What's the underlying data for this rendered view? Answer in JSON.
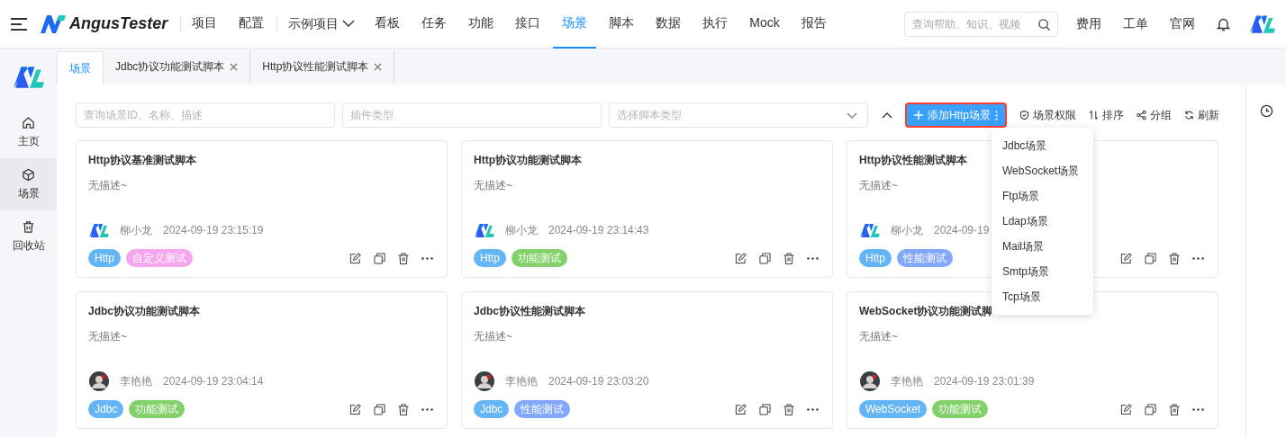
{
  "header": {
    "brand": "AngusTester",
    "settings_menu": [
      {
        "label": "项目",
        "selected": false
      },
      {
        "label": "配置",
        "selected": false
      }
    ],
    "project_selector": "示例项目",
    "main_menu": [
      {
        "label": "看板",
        "selected": false
      },
      {
        "label": "任务",
        "selected": false
      },
      {
        "label": "功能",
        "selected": false
      },
      {
        "label": "接口",
        "selected": false
      },
      {
        "label": "场景",
        "selected": true
      },
      {
        "label": "脚本",
        "selected": false
      },
      {
        "label": "数据",
        "selected": false
      },
      {
        "label": "执行",
        "selected": false
      },
      {
        "label": "Mock",
        "selected": false
      },
      {
        "label": "报告",
        "selected": false
      }
    ],
    "search": {
      "placeholder": "查询帮助、知识、视频"
    },
    "links": [
      "费用",
      "工单",
      "官网"
    ]
  },
  "tabs": [
    {
      "label": "场景",
      "selected": true,
      "closable": false
    },
    {
      "label": "Jdbc协议功能测试脚本",
      "selected": false,
      "closable": true
    },
    {
      "label": "Http协议性能测试脚本",
      "selected": false,
      "closable": true
    }
  ],
  "sidebar": {
    "items": [
      {
        "label": "主页",
        "kind": "home",
        "selected": false
      },
      {
        "label": "场景",
        "kind": "cube",
        "selected": true
      },
      {
        "label": "回收站",
        "kind": "trash",
        "selected": false
      }
    ]
  },
  "toolbar": {
    "search": {
      "placeholder": "查询场景ID、名称、描述"
    },
    "plugin": {
      "placeholder": "插件类型"
    },
    "script_type": {
      "placeholder": "选择脚本类型"
    },
    "add_button": "添加Http场景",
    "actions": [
      {
        "label": "场景权限",
        "kind": "shield"
      },
      {
        "label": "排序",
        "kind": "sort"
      },
      {
        "label": "分组",
        "kind": "group"
      },
      {
        "label": "刷新",
        "kind": "refresh"
      }
    ]
  },
  "add_menu": {
    "items": [
      "Jdbc场景",
      "WebSocket场景",
      "Ftp场景",
      "Ldap场景",
      "Mail场景",
      "Smtp场景",
      "Tcp场景"
    ]
  },
  "cards": [
    {
      "title": "Http协议基准测试脚本",
      "description": "无描述~",
      "author": "柳小龙",
      "avatar": {
        "kind": "logo"
      },
      "time": "2024-09-19 23:15:19",
      "tags": [
        {
          "label": "Http",
          "color": "#64b5f6"
        },
        {
          "label": "自定义测试",
          "color": "#f6a5ef"
        }
      ]
    },
    {
      "title": "Http协议功能测试脚本",
      "description": "无描述~",
      "author": "柳小龙",
      "avatar": {
        "kind": "logo"
      },
      "time": "2024-09-19 23:14:43",
      "tags": [
        {
          "label": "Http",
          "color": "#64b5f6"
        },
        {
          "label": "功能测试",
          "color": "#82d16a"
        }
      ]
    },
    {
      "title": "Http协议性能测试脚本",
      "description": "无描述~",
      "author": "柳小龙",
      "avatar": {
        "kind": "logo"
      },
      "time": "2024-09-19",
      "tags": [
        {
          "label": "Http",
          "color": "#64b5f6"
        },
        {
          "label": "性能测试",
          "color": "#82a8fb"
        }
      ]
    },
    {
      "title": "Jdbc协议功能测试脚本",
      "description": "无描述~",
      "author": "李艳艳",
      "avatar": {
        "kind": "photo"
      },
      "time": "2024-09-19 23:04:14",
      "tags": [
        {
          "label": "Jdbc",
          "color": "#64b5f6"
        },
        {
          "label": "功能测试",
          "color": "#82d16a"
        }
      ]
    },
    {
      "title": "Jdbc协议性能测试脚本",
      "description": "无描述~",
      "author": "李艳艳",
      "avatar": {
        "kind": "photo"
      },
      "time": "2024-09-19 23:03:20",
      "tags": [
        {
          "label": "Jdbc",
          "color": "#64b5f6"
        },
        {
          "label": "性能测试",
          "color": "#82a8fb"
        }
      ]
    },
    {
      "title": "WebSocket协议功能测试脚",
      "description": "无描述~",
      "author": "李艳艳",
      "avatar": {
        "kind": "photo"
      },
      "time": "2024-09-19 23:01:39",
      "tags": [
        {
          "label": "WebSocket",
          "color": "#64b5f6"
        },
        {
          "label": "功能测试",
          "color": "#82d16a"
        }
      ]
    }
  ]
}
